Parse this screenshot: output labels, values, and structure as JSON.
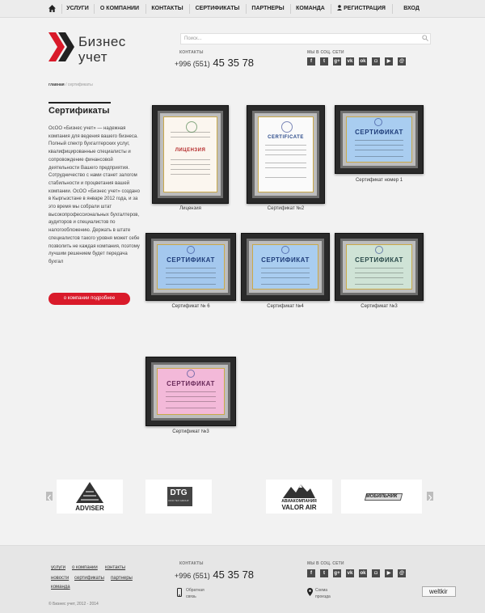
{
  "nav": {
    "items": [
      "Услуги",
      "О компании",
      "Контакты",
      "Сертификаты",
      "Партнеры",
      "Команда",
      "Регистрация",
      "Вход"
    ]
  },
  "header": {
    "logo_line1": "Бизнес",
    "logo_line2": "учет",
    "search_placeholder": "Поиск...",
    "contacts_label": "контакты",
    "phone_prefix": "+996 (551)",
    "phone_number": "45 35 78",
    "social_label": "мы в соц. сети",
    "social_icons": [
      "facebook-icon",
      "twitter-icon",
      "googleplus-icon",
      "vk-icon",
      "odnoklassniki-icon",
      "instagram-icon",
      "youtube-icon",
      "moimir-icon"
    ]
  },
  "breadcrumb": {
    "home": "главная",
    "separator": "/",
    "current": "сертификаты"
  },
  "sidebar": {
    "title": "Сертификаты",
    "text": "ОсОО «Бизнес учет» — надежная компания для ведения вашего бизнеса. Полный спектр бухгалтерских услуг, квалифицированные специалисты и сопровождение финансовой деятельности Вашего предприятия. Сотрудничество с нами станет залогом стабильности и процветания вашей компании. ОсОО «Бизнес учет» создано в Кыргызстане в январе 2012 года, и за это время мы собрали штат высокопрофессиональных бухгалтеров, аудиторов и специалистов по налогообложению. Держать в штате специалистов такого уровня может себе позволить не каждая компания, поэтому лучшим решением будет передача бухгал",
    "button": "о компании подробнее"
  },
  "certificates": [
    {
      "caption": "Лицензия",
      "heading": "ЛИЦЕНЗИЯ"
    },
    {
      "caption": "Сертификат №2",
      "heading": "CERTIFICATE"
    },
    {
      "caption": "Сертификат номер 1",
      "heading": "СЕРТИФИКАТ"
    },
    {
      "caption": "Сертификат № 6",
      "heading": "СЕРТИФИКАТ"
    },
    {
      "caption": "Сертификат №4",
      "heading": "СЕРТИФИКАТ"
    },
    {
      "caption": "Сертификат №3",
      "heading": "СЕРТИФИКАТ"
    },
    {
      "caption": "Сертификат №3",
      "heading": "СЕРТИФИКАТ"
    }
  ],
  "partners": {
    "items": [
      {
        "name": "ADVISER"
      },
      {
        "name": "DTG",
        "sub": "DOO TEX GROUP"
      },
      {
        "name": "АВИАКОМПАНИЯ",
        "sub": "VALOR AIR"
      },
      {
        "name": "МОБИЛЬНИК"
      }
    ]
  },
  "footer": {
    "links_row1": [
      "услуги",
      "о компании",
      "контакты"
    ],
    "links_row2": [
      "новости",
      "сертификаты",
      "партнеры"
    ],
    "links_row3": [
      "команда"
    ],
    "contacts_label": "контакты",
    "phone_prefix": "+996 (551)",
    "phone_number": "45 35 78",
    "feedback_line1": "Обратная",
    "feedback_line2": "связь",
    "map_line1": "Схема",
    "map_line2": "проезда",
    "social_label": "мы в соц. сети",
    "weltkir": "weltkir",
    "copyright": "© Бизнес учет, 2012 - 2014"
  },
  "colors": {
    "accent": "#d91a2a",
    "dark": "#222222",
    "social_bg": "#4a4a4a",
    "blue_cert": "#9cc3ea",
    "pink_cert": "#f2b8d8"
  }
}
